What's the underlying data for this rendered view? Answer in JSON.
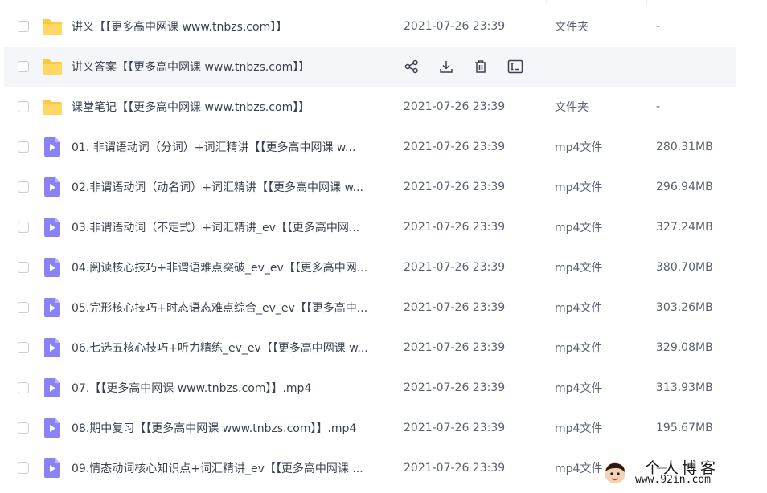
{
  "files": [
    {
      "kind": "folder",
      "name": "讲义【【更多高中网课 www.tnbzs.com】】",
      "date": "2021-07-26 23:39",
      "type": "文件夹",
      "size": "-"
    },
    {
      "kind": "folder",
      "name": "讲义答案【【更多高中网课 www.tnbzs.com】】",
      "date": "",
      "type": "",
      "size": "",
      "hover": true
    },
    {
      "kind": "folder",
      "name": "课堂笔记【【更多高中网课 www.tnbzs.com】】",
      "date": "2021-07-26 23:39",
      "type": "文件夹",
      "size": "-"
    },
    {
      "kind": "video",
      "name": "01. 非谓语动词（分词）+词汇精讲【【更多高中网课 w...",
      "date": "2021-07-26 23:39",
      "type": "mp4文件",
      "size": "280.31MB"
    },
    {
      "kind": "video",
      "name": "02.非谓语动词（动名词）+词汇精讲【【更多高中网课 w...",
      "date": "2021-07-26 23:39",
      "type": "mp4文件",
      "size": "296.94MB"
    },
    {
      "kind": "video",
      "name": "03.非谓语动词（不定式）+词汇精讲_ev【【更多高中网...",
      "date": "2021-07-26 23:39",
      "type": "mp4文件",
      "size": "327.24MB"
    },
    {
      "kind": "video",
      "name": "04.阅读核心技巧+非谓语难点突破_ev_ev【【更多高中网...",
      "date": "2021-07-26 23:39",
      "type": "mp4文件",
      "size": "380.70MB"
    },
    {
      "kind": "video",
      "name": "05.完形核心技巧+时态语态难点综合_ev_ev【【更多高中...",
      "date": "2021-07-26 23:39",
      "type": "mp4文件",
      "size": "303.26MB"
    },
    {
      "kind": "video",
      "name": "06.七选五核心技巧+听力精练_ev_ev【【更多高中网课 w...",
      "date": "2021-07-26 23:39",
      "type": "mp4文件",
      "size": "329.08MB"
    },
    {
      "kind": "video",
      "name": "07.【【更多高中网课 www.tnbzs.com】】.mp4",
      "date": "2021-07-26 23:39",
      "type": "mp4文件",
      "size": "313.93MB"
    },
    {
      "kind": "video",
      "name": "08.期中复习【【更多高中网课 www.tnbzs.com】】.mp4",
      "date": "2021-07-26 23:39",
      "type": "mp4文件",
      "size": "195.67MB"
    },
    {
      "kind": "video",
      "name": "09.情态动词核心知识点+词汇精讲_ev【【更多高中网课 ...",
      "date": "2021-07-26 23:39",
      "type": "mp4文件",
      "size": "—"
    }
  ],
  "row_actions": [
    {
      "icon": "share-icon"
    },
    {
      "icon": "download-icon"
    },
    {
      "icon": "delete-icon"
    },
    {
      "icon": "rename-icon"
    }
  ],
  "watermark": {
    "title": "个人博客",
    "url": "www.92in.com"
  },
  "colors": {
    "folder": "#ffc83d",
    "video": "#8a82f5",
    "hover_bg": "#f5f6fa",
    "text": "#3a4150"
  }
}
